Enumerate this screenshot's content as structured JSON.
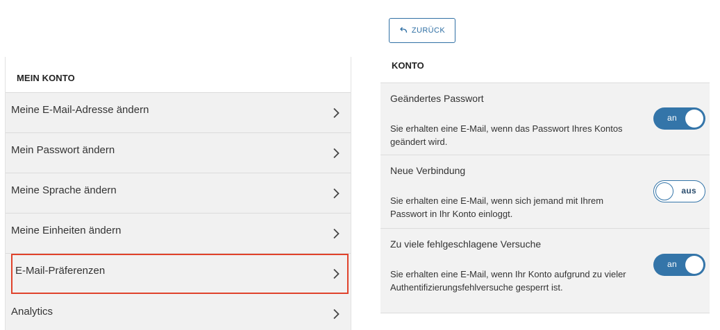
{
  "back": {
    "label": "ZURÜCK",
    "icon": "return-arrow-icon"
  },
  "sidebar": {
    "header": "MEIN KONTO",
    "items": [
      {
        "label": "Meine E-Mail-Adresse ändern",
        "selected": false
      },
      {
        "label": "Mein Passwort ändern",
        "selected": false
      },
      {
        "label": "Meine Sprache ändern",
        "selected": false
      },
      {
        "label": "Meine Einheiten ändern",
        "selected": false
      },
      {
        "label": "E-Mail-Präferenzen",
        "selected": true
      },
      {
        "label": "Analytics",
        "selected": false
      }
    ]
  },
  "main": {
    "section_title": "KONTO",
    "preferences": [
      {
        "title": "Geändertes Passwort",
        "description": "Sie erhalten eine E-Mail, wenn das Passwort Ihres Kontos geändert wird.",
        "toggle_state": "on",
        "toggle_label": "an"
      },
      {
        "title": "Neue Verbindung",
        "description": "Sie erhalten eine E-Mail, wenn sich jemand mit Ihrem Passwort in Ihr Konto einloggt.",
        "toggle_state": "off",
        "toggle_label": "aus"
      },
      {
        "title": "Zu viele fehlgeschlagene Versuche",
        "description": "Sie erhalten eine E-Mail, wenn Ihr Konto aufgrund zu vieler Authentifizierungsfehlversuche gesperrt ist.",
        "toggle_state": "on",
        "toggle_label": "an"
      }
    ]
  },
  "colors": {
    "accent": "#3475a9",
    "selection_outline": "#e0422b",
    "panel_background": "#f2f2f2"
  }
}
